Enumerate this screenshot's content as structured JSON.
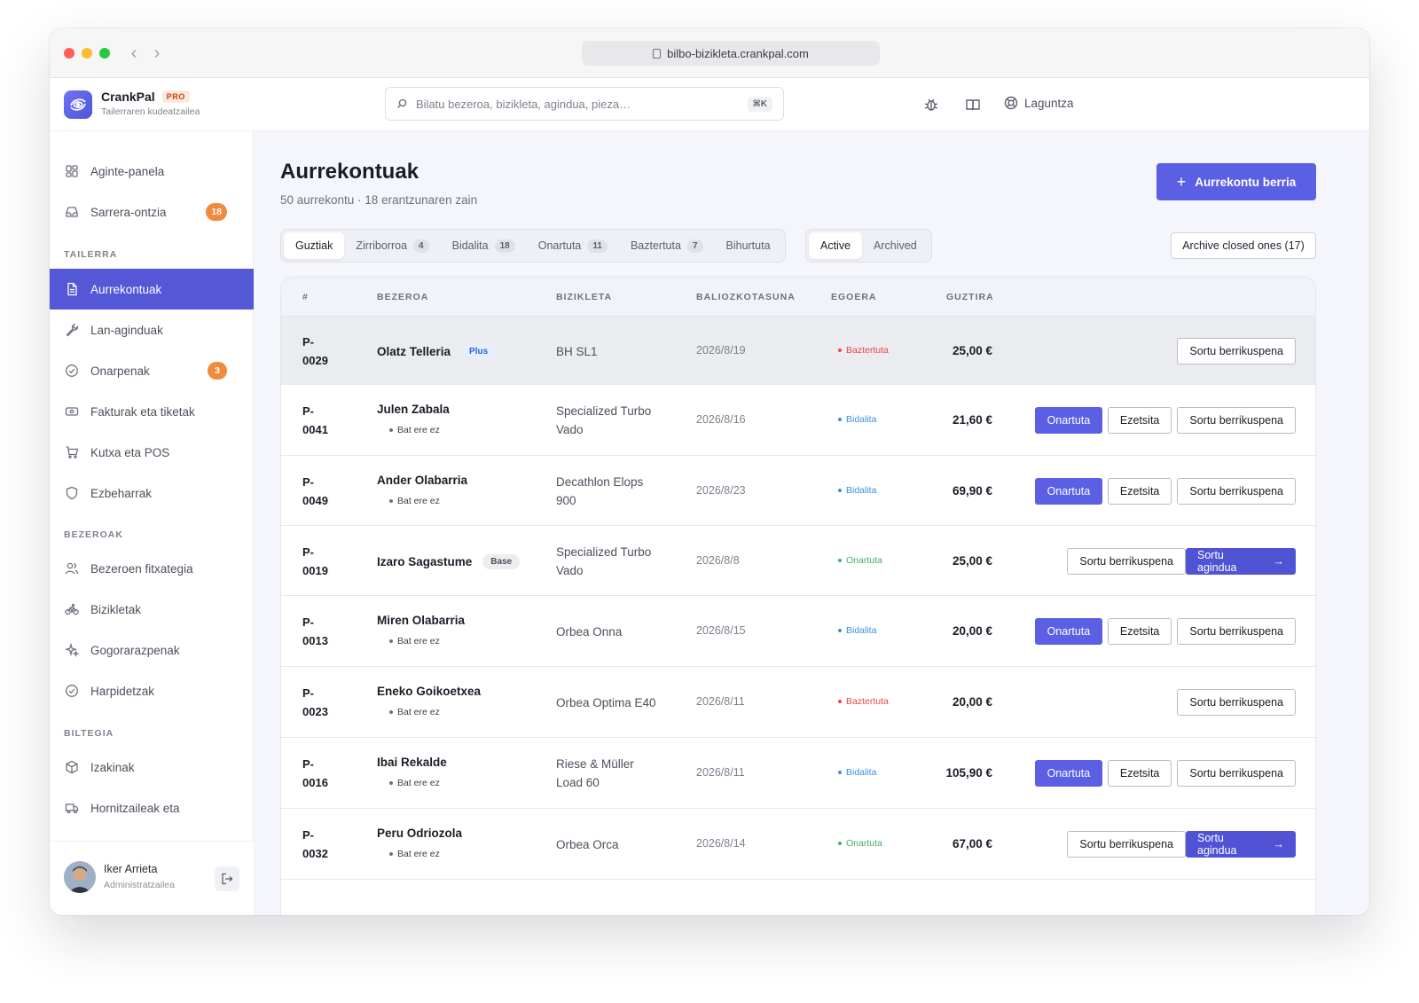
{
  "browser": {
    "url": "bilbo-bizikleta.crankpal.com"
  },
  "app": {
    "name": "CrankPal",
    "badge": "PRO",
    "subtitle": "Tailerraren kudeatzailea"
  },
  "search": {
    "placeholder": "Bilatu bezeroa, bizikleta, agindua, pieza…",
    "shortcut": "⌘K"
  },
  "header": {
    "help_label": "Laguntza"
  },
  "sidebar": {
    "top_items": [
      {
        "label": "Aginte-panela",
        "icon": "dashboard-icon"
      },
      {
        "label": "Sarrera-ontzia",
        "icon": "inbox-icon",
        "badge": "18"
      }
    ],
    "sections": [
      {
        "title": "TAILERRA"
      },
      {
        "title": "BEZEROAK"
      },
      {
        "title": "BILTEGIA"
      }
    ],
    "tailerra_items": [
      {
        "label": "Aurrekontuak",
        "icon": "document-icon"
      },
      {
        "label": "Lan-aginduak",
        "icon": "wrench-icon"
      },
      {
        "label": "Onarpenak",
        "icon": "check-circle-icon",
        "badge": "3"
      },
      {
        "label": "Fakturak eta tiketak",
        "icon": "ticket-icon"
      },
      {
        "label": "Kutxa eta POS",
        "icon": "cart-icon"
      },
      {
        "label": "Ezbeharrak",
        "icon": "shield-icon"
      }
    ],
    "bezeroak_items": [
      {
        "label": "Bezeroen fitxategia",
        "icon": "users-icon"
      },
      {
        "label": "Bizikletak",
        "icon": "bike-icon"
      },
      {
        "label": "Gogorarazpenak",
        "icon": "sparkle-icon"
      },
      {
        "label": "Harpidetzak",
        "icon": "check-circle-icon"
      }
    ],
    "biltegia_items": [
      {
        "label": "Izakinak",
        "icon": "box-icon"
      },
      {
        "label": "Hornitzaileak eta",
        "icon": "truck-icon"
      }
    ],
    "user": {
      "name": "Iker Arrieta",
      "role": "Administratzailea"
    }
  },
  "page": {
    "title": "Aurrekontuak",
    "subtitle": "50 aurrekontu · 18 erantzunaren zain",
    "new_button": "Aurrekontu berria",
    "archive_button": "Archive closed ones (17)"
  },
  "status_tabs": [
    {
      "label": "Guztiak",
      "count": ""
    },
    {
      "label": "Zirriborroa",
      "count": "4"
    },
    {
      "label": "Bidalita",
      "count": "18"
    },
    {
      "label": "Onartuta",
      "count": "11"
    },
    {
      "label": "Baztertuta",
      "count": "7"
    },
    {
      "label": "Bihurtuta",
      "count": ""
    }
  ],
  "view_tabs": [
    {
      "label": "Active"
    },
    {
      "label": "Archived"
    }
  ],
  "table": {
    "columns": [
      "#",
      "BEZEROA",
      "BIZIKLETA",
      "BALIOZKOTASUNA",
      "EGOERA",
      "GUZTIRA"
    ],
    "action_labels": {
      "approve": "Onartuta",
      "reject": "Ezetsita",
      "revise": "Sortu berrikuspena",
      "order": "Sortu agindua"
    },
    "rows": [
      {
        "id1": "P-",
        "id2": "0029",
        "customer": "Olatz Telleria",
        "plan": "Plus",
        "sub": "",
        "bike1": "BH SL1",
        "bike2": "",
        "valid": "2026/8/19",
        "status": "Baztertuta",
        "total": "25,00 €"
      },
      {
        "id1": "P-",
        "id2": "0041",
        "customer": "Julen Zabala",
        "plan": "",
        "sub": "Bat ere ez",
        "bike1": "Specialized Turbo",
        "bike2": "Vado",
        "valid": "2026/8/16",
        "status": "Bidalita",
        "total": "21,60 €"
      },
      {
        "id1": "P-",
        "id2": "0049",
        "customer": "Ander Olabarria",
        "plan": "",
        "sub": "Bat ere ez",
        "bike1": "Decathlon Elops",
        "bike2": "900",
        "valid": "2026/8/23",
        "status": "Bidalita",
        "total": "69,90 €"
      },
      {
        "id1": "P-",
        "id2": "0019",
        "customer": "Izaro Sagastume",
        "plan": "Base",
        "sub": "",
        "bike1": "Specialized Turbo",
        "bike2": "Vado",
        "valid": "2026/8/8",
        "status": "Onartuta",
        "total": "25,00 €"
      },
      {
        "id1": "P-",
        "id2": "0013",
        "customer": "Miren Olabarria",
        "plan": "",
        "sub": "Bat ere ez",
        "bike1": "Orbea Onna",
        "bike2": "",
        "valid": "2026/8/15",
        "status": "Bidalita",
        "total": "20,00 €"
      },
      {
        "id1": "P-",
        "id2": "0023",
        "customer": "Eneko Goikoetxea",
        "plan": "",
        "sub": "Bat ere ez",
        "bike1": "Orbea Optima E40",
        "bike2": "",
        "valid": "2026/8/11",
        "status": "Baztertuta",
        "total": "20,00 €"
      },
      {
        "id1": "P-",
        "id2": "0016",
        "customer": "Ibai Rekalde",
        "plan": "",
        "sub": "Bat ere ez",
        "bike1": "Riese & Müller",
        "bike2": "Load 60",
        "valid": "2026/8/11",
        "status": "Bidalita",
        "total": "105,90 €"
      },
      {
        "id1": "P-",
        "id2": "0032",
        "customer": "Peru Odriozola",
        "plan": "",
        "sub": "Bat ere ez",
        "bike1": "Orbea Orca",
        "bike2": "",
        "valid": "2026/8/14",
        "status": "Onartuta",
        "total": "67,00 €"
      }
    ]
  },
  "colors": {
    "accent": "#5b5fe3",
    "status_rejected": "#e5484d",
    "status_sent": "#3b8fe0",
    "status_approved": "#3fb068",
    "badge_orange": "#f08a3c"
  }
}
